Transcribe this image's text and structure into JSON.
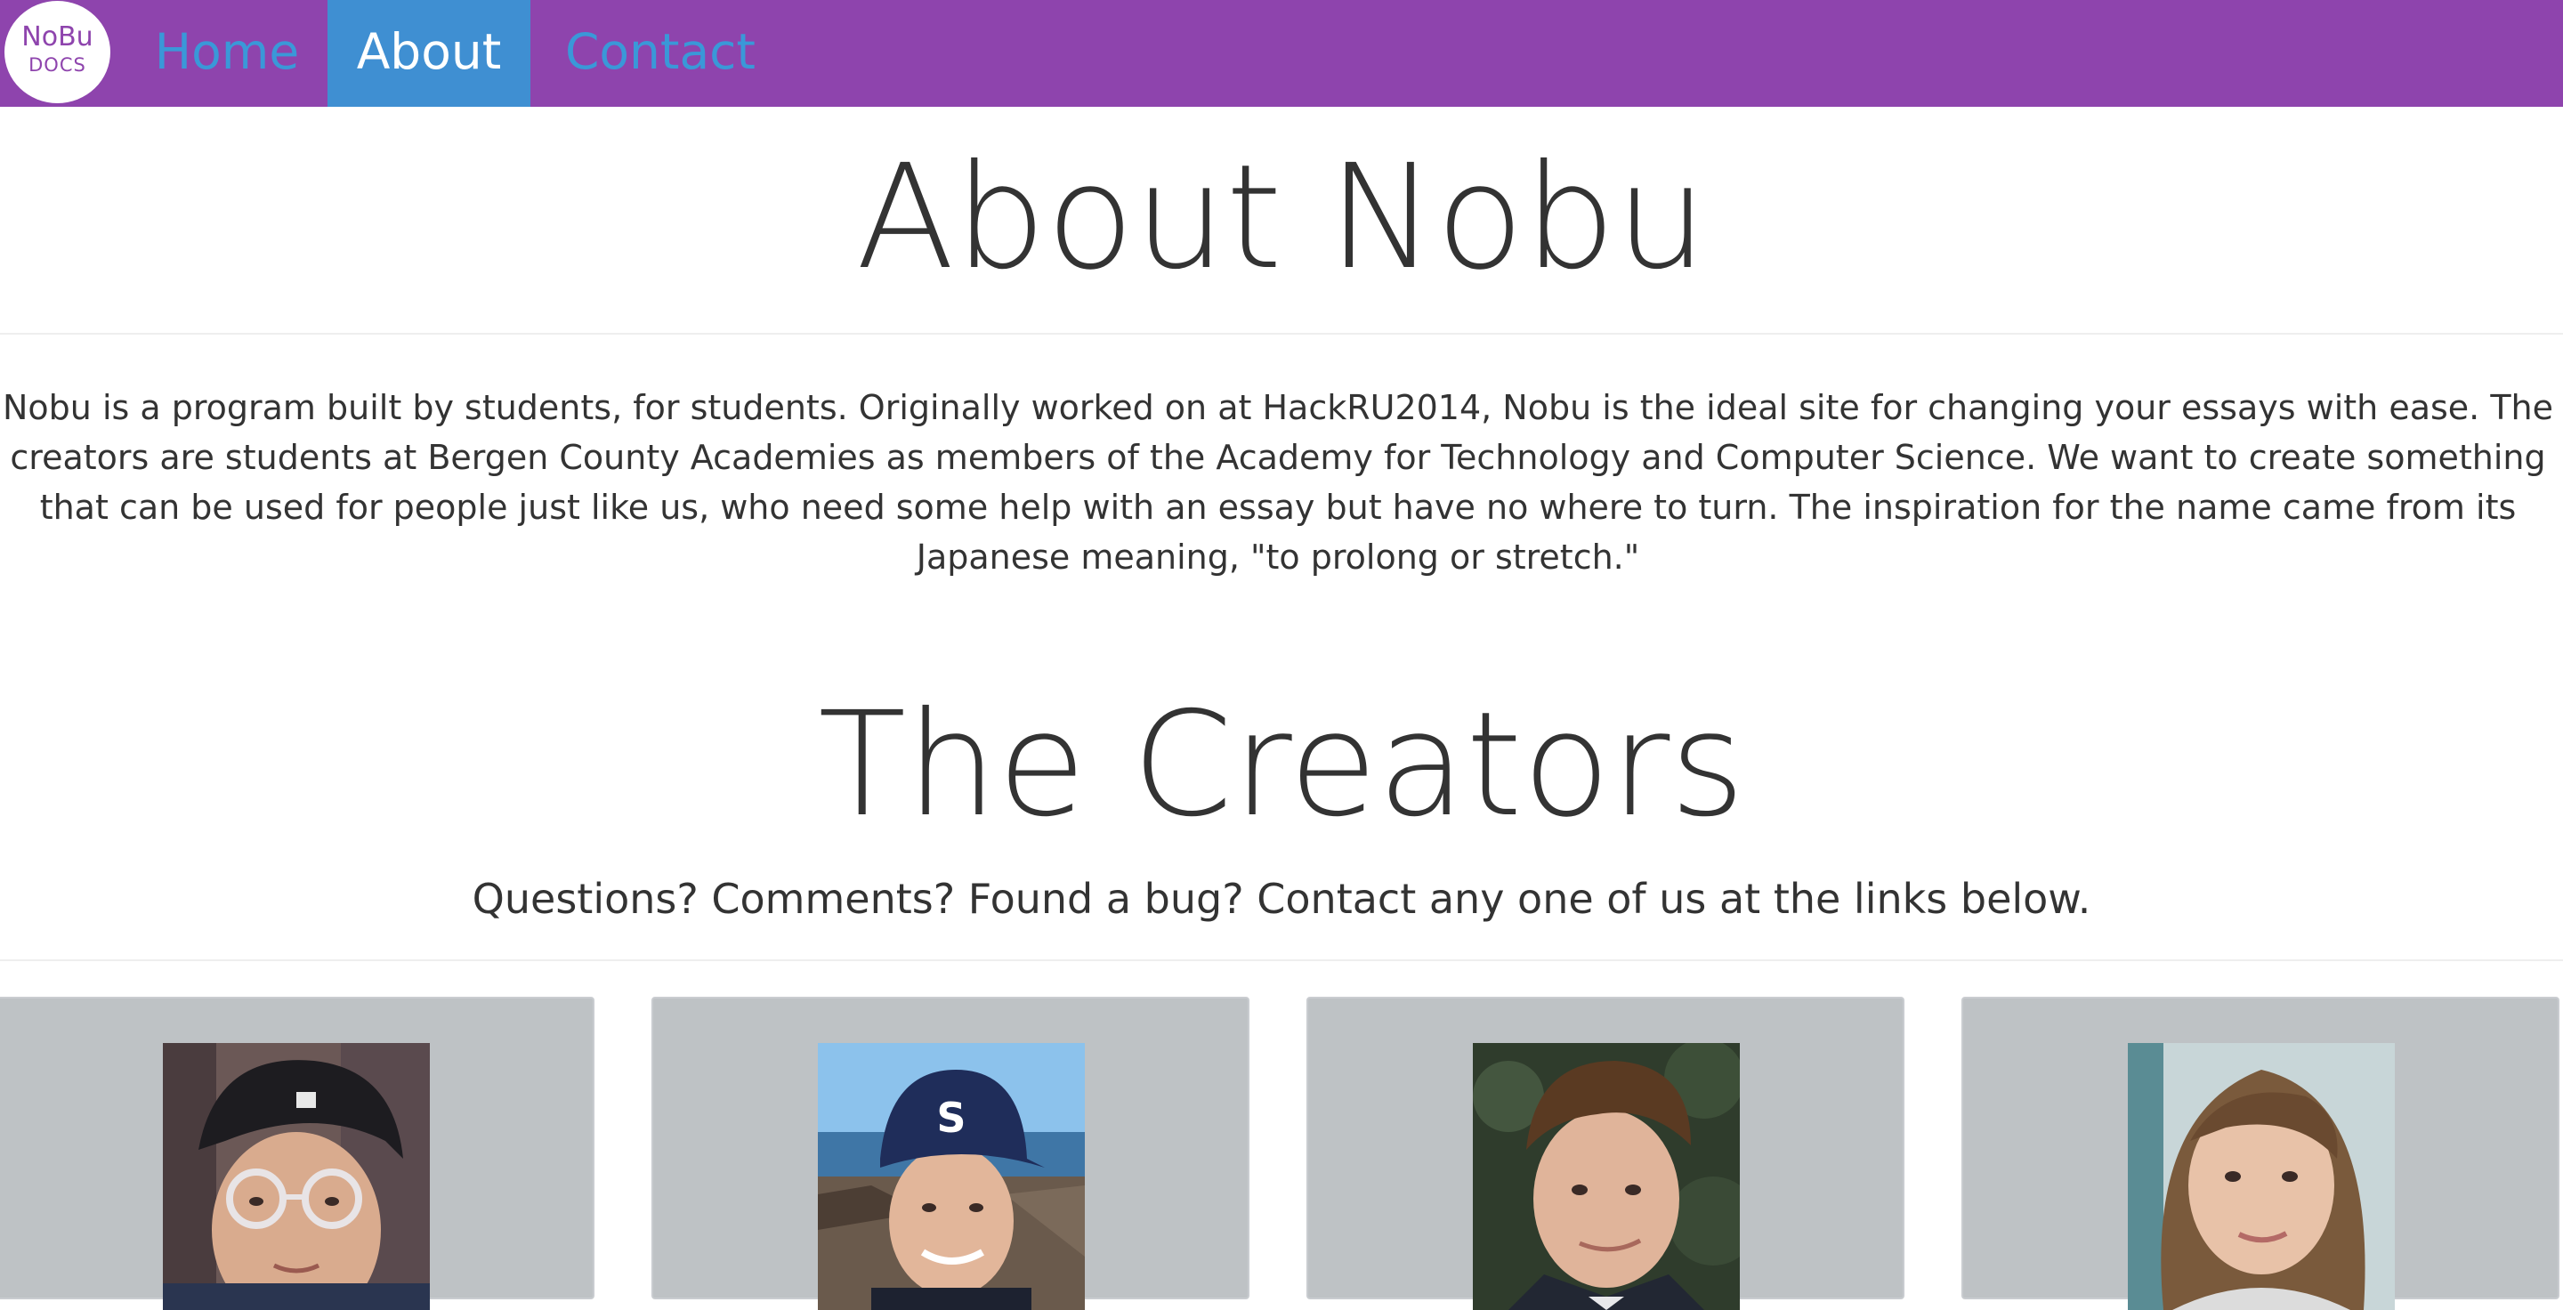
{
  "navbar": {
    "logo": {
      "line1": "NoBu",
      "line2": "DOCS"
    },
    "links": [
      {
        "label": "Home",
        "active": false
      },
      {
        "label": "About",
        "active": true
      },
      {
        "label": "Contact",
        "active": false
      }
    ]
  },
  "about": {
    "title": "About Nobu",
    "paragraph": "Nobu is a program built by students, for students. Originally worked on at HackRU2014, Nobu is the ideal site for changing your essays with ease. The creators are students at Bergen County Academies as members of the Academy for Technology and Computer Science. We want to create something that can be used for people just like us, who need some help with an essay but have no where to turn. The inspiration for the name came from its Japanese meaning, \"to prolong or stretch.\""
  },
  "creators": {
    "title": "The Creators",
    "subtitle": "Questions? Comments? Found a bug? Contact any one of us at the links below.",
    "cards": [
      {
        "photo": "creator-photo-glasses-cap"
      },
      {
        "photo": "creator-photo-blue-cap"
      },
      {
        "photo": "creator-photo-suit"
      },
      {
        "photo": "creator-photo-brown-hair"
      }
    ]
  },
  "colors": {
    "navbar_bg": "#8e44ad",
    "nav_link": "#3a98d8",
    "nav_active_bg": "#3f8fd2",
    "card_bg": "#bec2c5"
  }
}
